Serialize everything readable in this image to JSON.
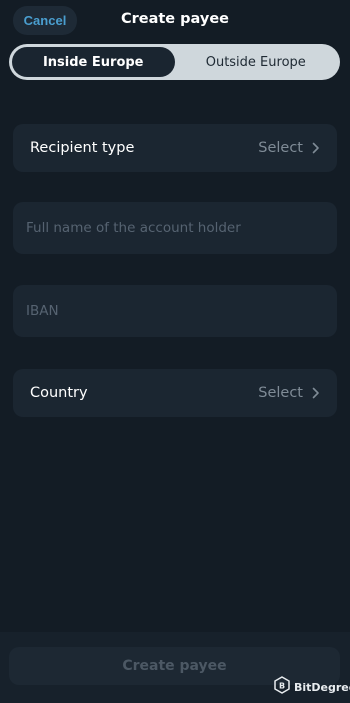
{
  "header": {
    "cancel_label": "Cancel",
    "title": "Create payee"
  },
  "segmented": {
    "options": [
      {
        "label": "Inside Europe",
        "selected": true
      },
      {
        "label": "Outside Europe",
        "selected": false
      }
    ]
  },
  "form": {
    "recipient_type": {
      "label": "Recipient type",
      "value": "Select"
    },
    "full_name": {
      "placeholder": "Full name of the account holder",
      "value": ""
    },
    "iban": {
      "placeholder": "IBAN",
      "value": ""
    },
    "country": {
      "label": "Country",
      "value": "Select"
    }
  },
  "footer": {
    "submit_label": "Create payee"
  },
  "watermark": {
    "text": "BitDegree"
  },
  "colors": {
    "background": "#131c25",
    "accent": "#4a9ecf",
    "field_background": "#1b2631",
    "segment_track": "#cfd7dc"
  },
  "icons": {
    "chevron": "chevron-right-icon",
    "watermark_logo": "bitdegree-logo-icon"
  }
}
